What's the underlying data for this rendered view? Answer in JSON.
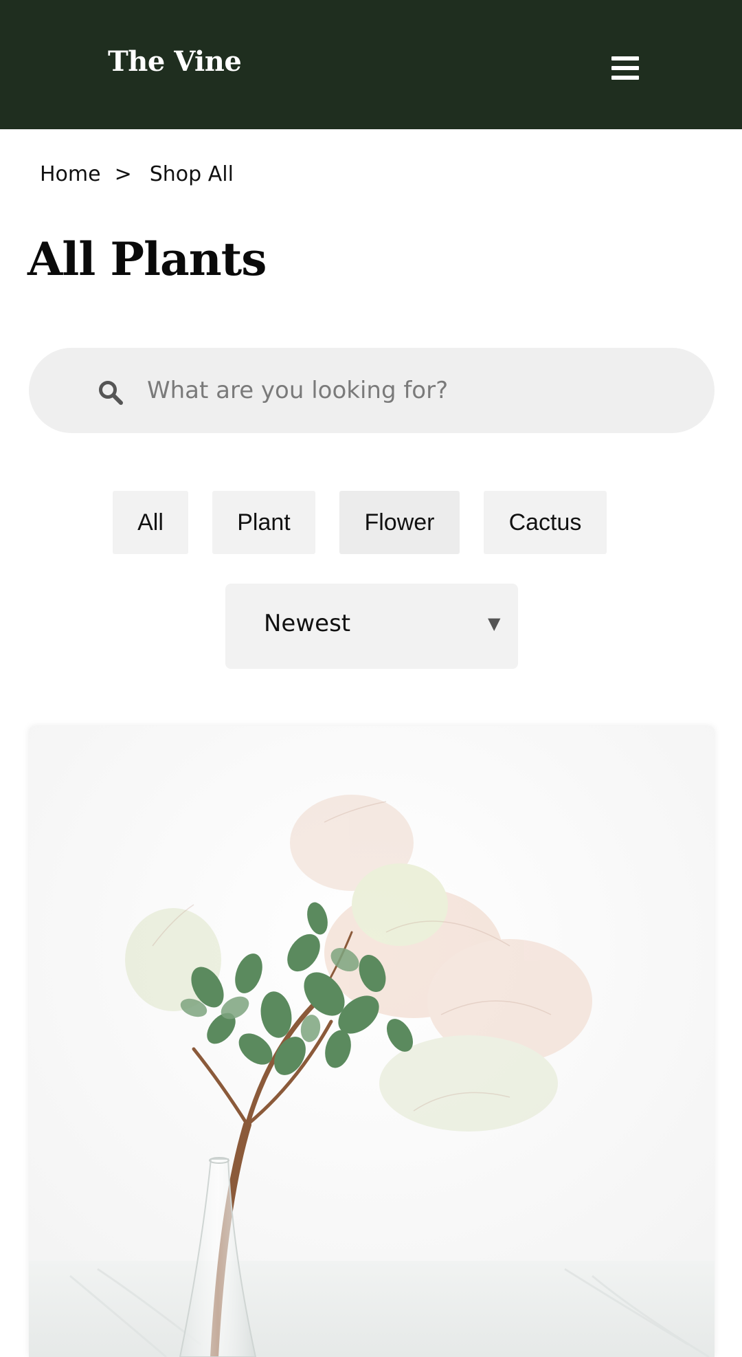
{
  "header": {
    "brand": "The Vine",
    "menu_icon": "hamburger-menu-icon",
    "background_color": "#1f2e1f"
  },
  "breadcrumb": {
    "items": [
      "Home",
      "Shop All"
    ],
    "separator": ">"
  },
  "page": {
    "title": "All Plants"
  },
  "search": {
    "placeholder": "What are you looking for?",
    "value": "",
    "icon": "search-icon"
  },
  "filters": {
    "items": [
      {
        "label": "All"
      },
      {
        "label": "Plant"
      },
      {
        "label": "Flower"
      },
      {
        "label": "Cactus"
      }
    ]
  },
  "sort": {
    "selected": "Newest",
    "arrow": "▼"
  },
  "product": {
    "image_subject": "plant-in-glass-vase"
  }
}
